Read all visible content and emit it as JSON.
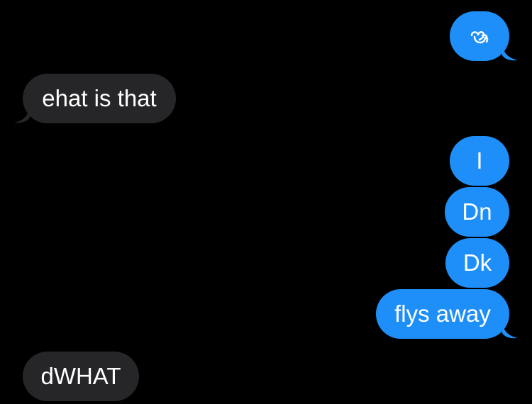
{
  "thread": {
    "messages": [
      {
        "direction": "sent",
        "text": "",
        "icon": "glyph-emoji-icon"
      },
      {
        "direction": "received",
        "text": "ehat is that"
      },
      {
        "direction": "sent",
        "text": "I"
      },
      {
        "direction": "sent",
        "text": "Dn"
      },
      {
        "direction": "sent",
        "text": "Dk"
      },
      {
        "direction": "sent",
        "text": "flys away"
      },
      {
        "direction": "received",
        "text": "dWHAT"
      }
    ]
  },
  "colors": {
    "background": "#000000",
    "sent_bubble": "#1e8ff8",
    "received_bubble": "#262629",
    "text": "#ffffff"
  }
}
